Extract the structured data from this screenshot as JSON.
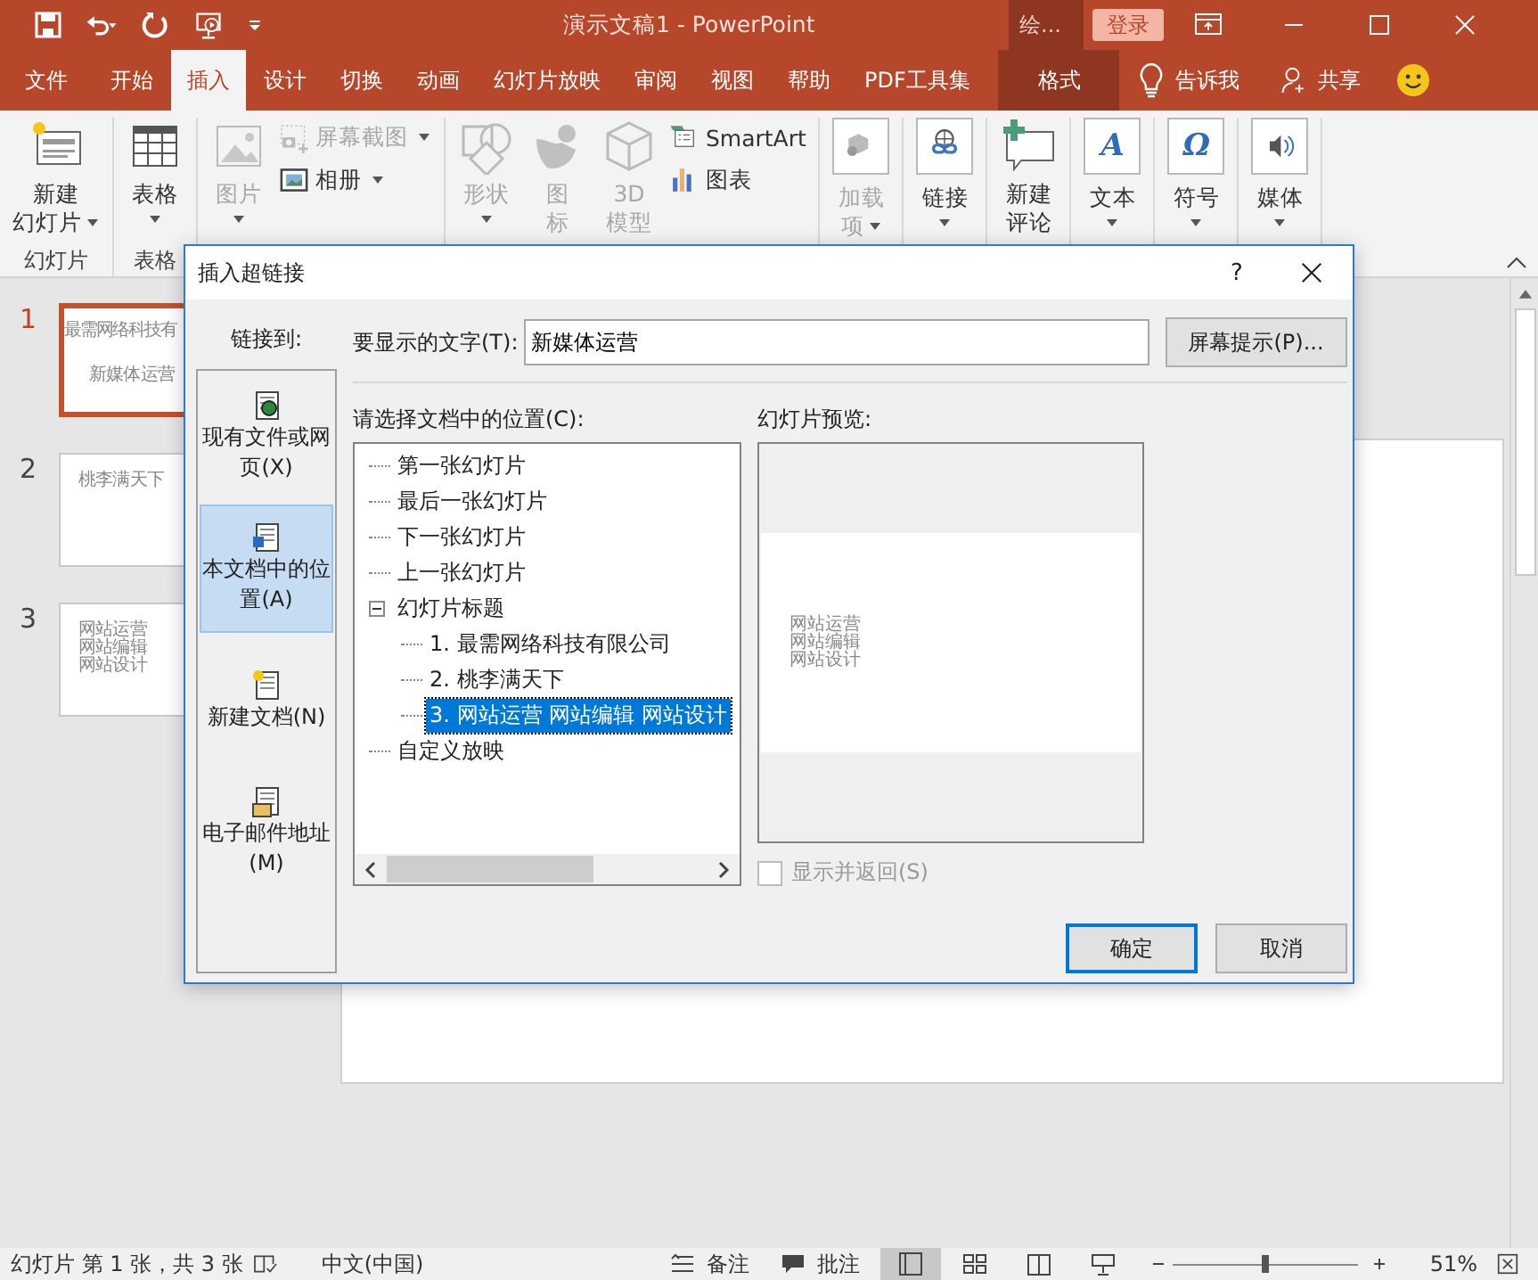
{
  "title_bar": {
    "title": "演示文稿1  -  PowerPoint",
    "context_label": "绘...",
    "login": "登录"
  },
  "ribbon_tabs": [
    {
      "label": "文件",
      "selected": false,
      "kind": "normal"
    },
    {
      "label": "开始",
      "selected": false,
      "kind": "normal"
    },
    {
      "label": "插入",
      "selected": true,
      "kind": "normal"
    },
    {
      "label": "设计",
      "selected": false,
      "kind": "normal"
    },
    {
      "label": "切换",
      "selected": false,
      "kind": "normal"
    },
    {
      "label": "动画",
      "selected": false,
      "kind": "normal"
    },
    {
      "label": "幻灯片放映",
      "selected": false,
      "kind": "normal"
    },
    {
      "label": "审阅",
      "selected": false,
      "kind": "normal"
    },
    {
      "label": "视图",
      "selected": false,
      "kind": "normal"
    },
    {
      "label": "帮助",
      "selected": false,
      "kind": "normal"
    },
    {
      "label": "PDF工具集",
      "selected": false,
      "kind": "normal"
    },
    {
      "label": "格式",
      "selected": false,
      "kind": "context"
    }
  ],
  "tell_me": "告诉我",
  "share": "共享",
  "ribbon_groups": [
    {
      "label": "幻灯片",
      "items": [
        {
          "kind": "large",
          "label_lines": [
            "新建",
            "幻灯片"
          ],
          "dropdown": true,
          "disabled": false
        }
      ]
    },
    {
      "label": "表格",
      "items": [
        {
          "kind": "large",
          "label_lines": [
            "表格"
          ],
          "dropdown": true,
          "disabled": false
        }
      ]
    },
    {
      "items": [
        {
          "kind": "large",
          "label_lines": [
            "图片"
          ],
          "dropdown": true,
          "disabled": true
        },
        {
          "kind": "small",
          "label_lines": [
            "屏幕截图"
          ],
          "dropdown": true,
          "disabled": true
        },
        {
          "kind": "small",
          "label_lines": [
            "相册"
          ],
          "dropdown": true,
          "disabled": false
        }
      ]
    },
    {
      "items": [
        {
          "kind": "large",
          "label_lines": [
            "形状"
          ],
          "dropdown": true,
          "disabled": true
        },
        {
          "kind": "large",
          "label_lines": [
            "图",
            "标"
          ],
          "dropdown": false,
          "disabled": true
        },
        {
          "kind": "large",
          "label_lines": [
            "3D",
            "模型"
          ],
          "dropdown": false,
          "disabled": true
        },
        {
          "kind": "small",
          "label_lines": [
            "SmartArt"
          ],
          "dropdown": false,
          "disabled": false
        },
        {
          "kind": "small",
          "label_lines": [
            "图表"
          ],
          "dropdown": false,
          "disabled": false
        }
      ]
    },
    {
      "items": [
        {
          "kind": "boxed",
          "label_lines": [
            "加载",
            "项"
          ],
          "dropdown": true,
          "disabled": true
        }
      ]
    },
    {
      "items": [
        {
          "kind": "boxed",
          "label_lines": [
            "链接"
          ],
          "dropdown": true,
          "disabled": false
        }
      ]
    },
    {
      "items": [
        {
          "kind": "large",
          "label_lines": [
            "新建",
            "评论"
          ],
          "dropdown": false,
          "disabled": false
        }
      ]
    },
    {
      "items": [
        {
          "kind": "boxed",
          "label_lines": [
            "文本"
          ],
          "dropdown": true,
          "disabled": false,
          "glyph": "A"
        }
      ]
    },
    {
      "items": [
        {
          "kind": "boxed",
          "label_lines": [
            "符号"
          ],
          "dropdown": true,
          "disabled": false,
          "glyph": "Ω"
        }
      ]
    },
    {
      "items": [
        {
          "kind": "boxed",
          "label_lines": [
            "媒体"
          ],
          "dropdown": true,
          "disabled": false
        }
      ]
    }
  ],
  "slides": [
    {
      "number": "1",
      "selected": true,
      "lines": [
        "最需网络科技有"
      ],
      "subtitle": "新媒体运营"
    },
    {
      "number": "2",
      "selected": false,
      "lines": [
        "桃李满天下"
      ]
    },
    {
      "number": "3",
      "selected": false,
      "lines": [
        "网站运营",
        "网站编辑",
        "网站设计"
      ]
    }
  ],
  "dialog": {
    "title": "插入超链接",
    "help": "?",
    "link_to_label": "链接到:",
    "link_to": [
      {
        "label": "现有文件或网页(X)",
        "selected": false
      },
      {
        "label": "本文档中的位置(A)",
        "selected": true
      },
      {
        "label": "新建文档(N)",
        "selected": false
      },
      {
        "label": "电子邮件地址(M)",
        "selected": false
      }
    ],
    "display_text_label": "要显示的文字(T):",
    "display_text": "新媒体运营",
    "screentip_button": "屏幕提示(P)...",
    "location_label": "请选择文档中的位置(C):",
    "tree": [
      {
        "label": "第一张幻灯片",
        "selected": false
      },
      {
        "label": "最后一张幻灯片",
        "selected": false
      },
      {
        "label": "下一张幻灯片",
        "selected": false
      },
      {
        "label": "上一张幻灯片",
        "selected": false
      },
      {
        "label": "幻灯片标题",
        "selected": false,
        "expanded": true,
        "children": [
          {
            "label": "1. 最需网络科技有限公司",
            "selected": false
          },
          {
            "label": "2. 桃李满天下",
            "selected": false
          },
          {
            "label": "3. 网站运营 网站编辑 网站设计",
            "selected": true
          }
        ]
      },
      {
        "label": "自定义放映",
        "selected": false
      }
    ],
    "preview_label": "幻灯片预览:",
    "preview_lines": [
      "网站运营",
      "网站编辑",
      "网站设计"
    ],
    "show_and_return": {
      "label": "显示并返回(S)",
      "checked": false,
      "disabled": true
    },
    "ok": "确定",
    "cancel": "取消"
  },
  "status_bar": {
    "slide_info": "幻灯片 第 1 张，共 3 张",
    "language": "中文(中国)",
    "notes": "备注",
    "comments": "批注",
    "views": [
      {
        "selected": true
      },
      {
        "selected": false
      },
      {
        "selected": false
      },
      {
        "selected": false
      }
    ],
    "zoom": {
      "level": 0.5
    },
    "zoom_text": "51%"
  }
}
